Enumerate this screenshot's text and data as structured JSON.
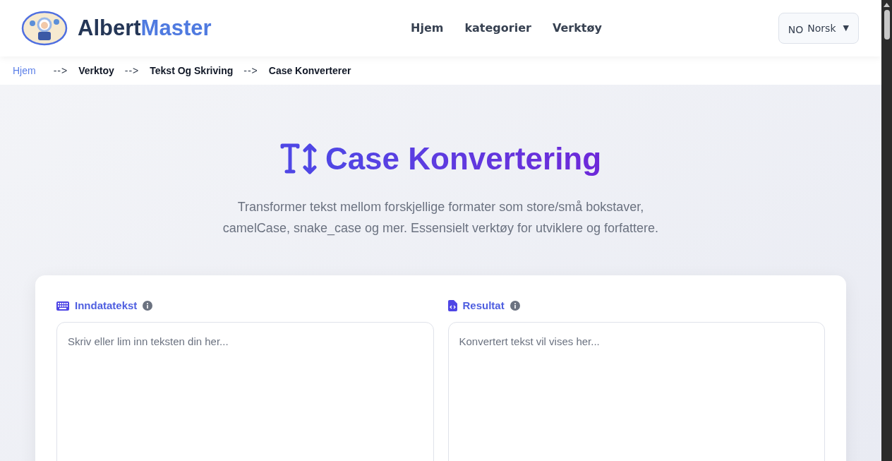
{
  "header": {
    "logo": {
      "name_part_1": "Albert",
      "name_part_2": "Master"
    },
    "nav": [
      "Hjem",
      "kategorier",
      "Verktøy"
    ],
    "language": {
      "code": "NO",
      "label": "Norsk",
      "caret": "▼"
    }
  },
  "breadcrumb": [
    {
      "label": "Hjem",
      "link": true
    },
    {
      "label": "-->",
      "kind": "separator"
    },
    {
      "label": "Verktoy",
      "link": false
    },
    {
      "label": "-->",
      "kind": "separator"
    },
    {
      "label": "Tekst Og Skriving",
      "link": false
    },
    {
      "label": "-->",
      "kind": "separator"
    },
    {
      "label": "Case Konverterer",
      "link": false
    }
  ],
  "hero": {
    "title": "Case Konvertering",
    "description": "Transformer tekst mellom forskjellige formater som store/små bokstaver, camelCase, snake_case og mer. Essensielt verktøy for utviklere og forfattere."
  },
  "panels": [
    {
      "kind": "input",
      "label": "Inndatatekst",
      "placeholder": "Skriv eller lim inn teksten din her..."
    },
    {
      "kind": "output",
      "label": "Resultat",
      "placeholder": "Konvertert tekst vil vises her..."
    }
  ]
}
